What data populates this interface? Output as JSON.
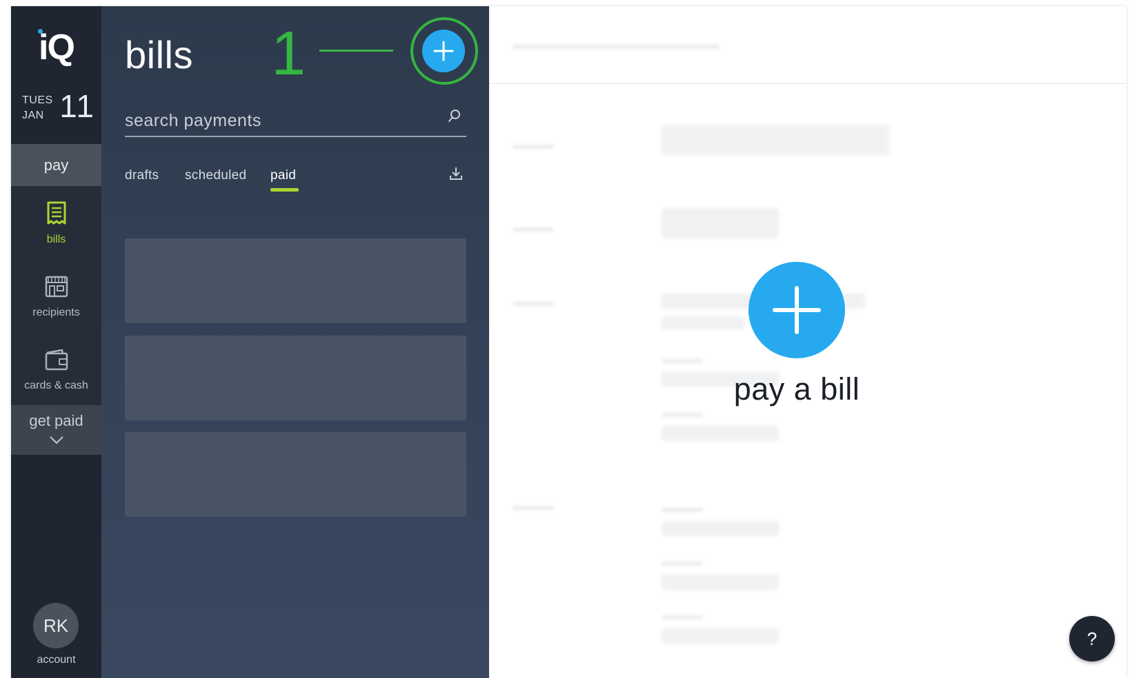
{
  "rail": {
    "logo": "iQ",
    "date": {
      "day": "TUES",
      "month": "JAN",
      "number": "11"
    },
    "pay_label": "pay",
    "items": [
      {
        "label": "bills",
        "icon": "receipt-icon",
        "active": true
      },
      {
        "label": "recipients",
        "icon": "storefront-icon",
        "active": false
      },
      {
        "label": "cards & cash",
        "icon": "wallet-icon",
        "active": false
      }
    ],
    "get_paid_label": "get paid",
    "avatar_initials": "RK",
    "account_label": "account"
  },
  "panel": {
    "title": "bills",
    "annotation_step": "1",
    "search": {
      "placeholder": "search payments",
      "value": ""
    },
    "tabs": [
      {
        "label": "drafts",
        "active": false
      },
      {
        "label": "scheduled",
        "active": false
      },
      {
        "label": "paid",
        "active": true
      }
    ]
  },
  "detail": {
    "cta_label": "pay a bill",
    "help_label": "?"
  },
  "colors": {
    "accent_blue": "#26a9ee",
    "active_green": "#a8d631",
    "annotation_green": "#35b541",
    "rail_bg": "#1f2531",
    "panel_bg": "#2d3a4c"
  }
}
